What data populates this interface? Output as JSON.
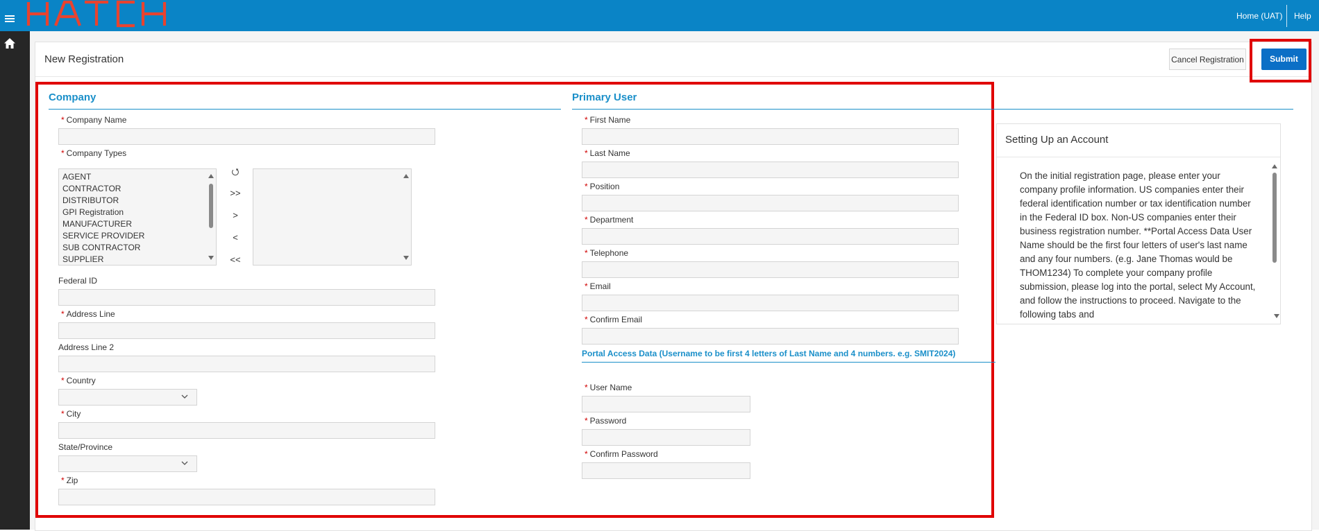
{
  "topbar": {
    "brand": "HATCH",
    "home_link": "Home (UAT)",
    "help_link": "Help"
  },
  "page": {
    "title": "New Registration",
    "cancel_label": "Cancel Registration",
    "submit_label": "Submit"
  },
  "company": {
    "title": "Company",
    "company_name_label": "Company Name",
    "company_types_label": "Company Types",
    "company_types_options": [
      "AGENT",
      "CONTRACTOR",
      "DISTRIBUTOR",
      "GPI Registration",
      "MANUFACTURER",
      "SERVICE PROVIDER",
      "SUB CONTRACTOR",
      "SUPPLIER"
    ],
    "shuttle_buttons": {
      "reset": "⭯",
      "move_all": ">>",
      "move": ">",
      "remove": "<",
      "remove_all": "<<"
    },
    "federal_id_label": "Federal ID",
    "address_line_label": "Address Line",
    "address_line2_label": "Address Line 2",
    "country_label": "Country",
    "city_label": "City",
    "state_label": "State/Province",
    "zip_label": "Zip"
  },
  "primary_user": {
    "title": "Primary User",
    "first_name_label": "First Name",
    "last_name_label": "Last Name",
    "position_label": "Position",
    "department_label": "Department",
    "telephone_label": "Telephone",
    "email_label": "Email",
    "confirm_email_label": "Confirm Email",
    "portal_title": "Portal Access Data (Username to be first 4 letters of Last Name and 4 numbers. e.g. SMIT2024)",
    "user_name_label": "User Name",
    "password_label": "Password",
    "confirm_password_label": "Confirm Password"
  },
  "help_card": {
    "title": "Setting Up an Account",
    "body": "On the initial registration page, please enter your company profile information. US companies enter their federal identification number or tax identification number in the Federal ID box. Non-US companies enter their business registration number. **Portal Access Data User Name should be the first four letters of user's last name and any four numbers. (e.g. Jane Thomas would be THOM1234) To complete your company profile submission, please log into the portal, select My Account, and follow the instructions to proceed. Navigate to the following tabs and"
  },
  "colors": {
    "topbar": "#0a84c6",
    "sidebar": "#262626",
    "accent": "#1a8fc9",
    "submit": "#0b6fc6",
    "highlight": "#e00000",
    "required": "#d00000"
  },
  "icons": {
    "menu": "hamburger-icon",
    "home": "home-icon",
    "dropdown": "chevron-down-icon"
  }
}
